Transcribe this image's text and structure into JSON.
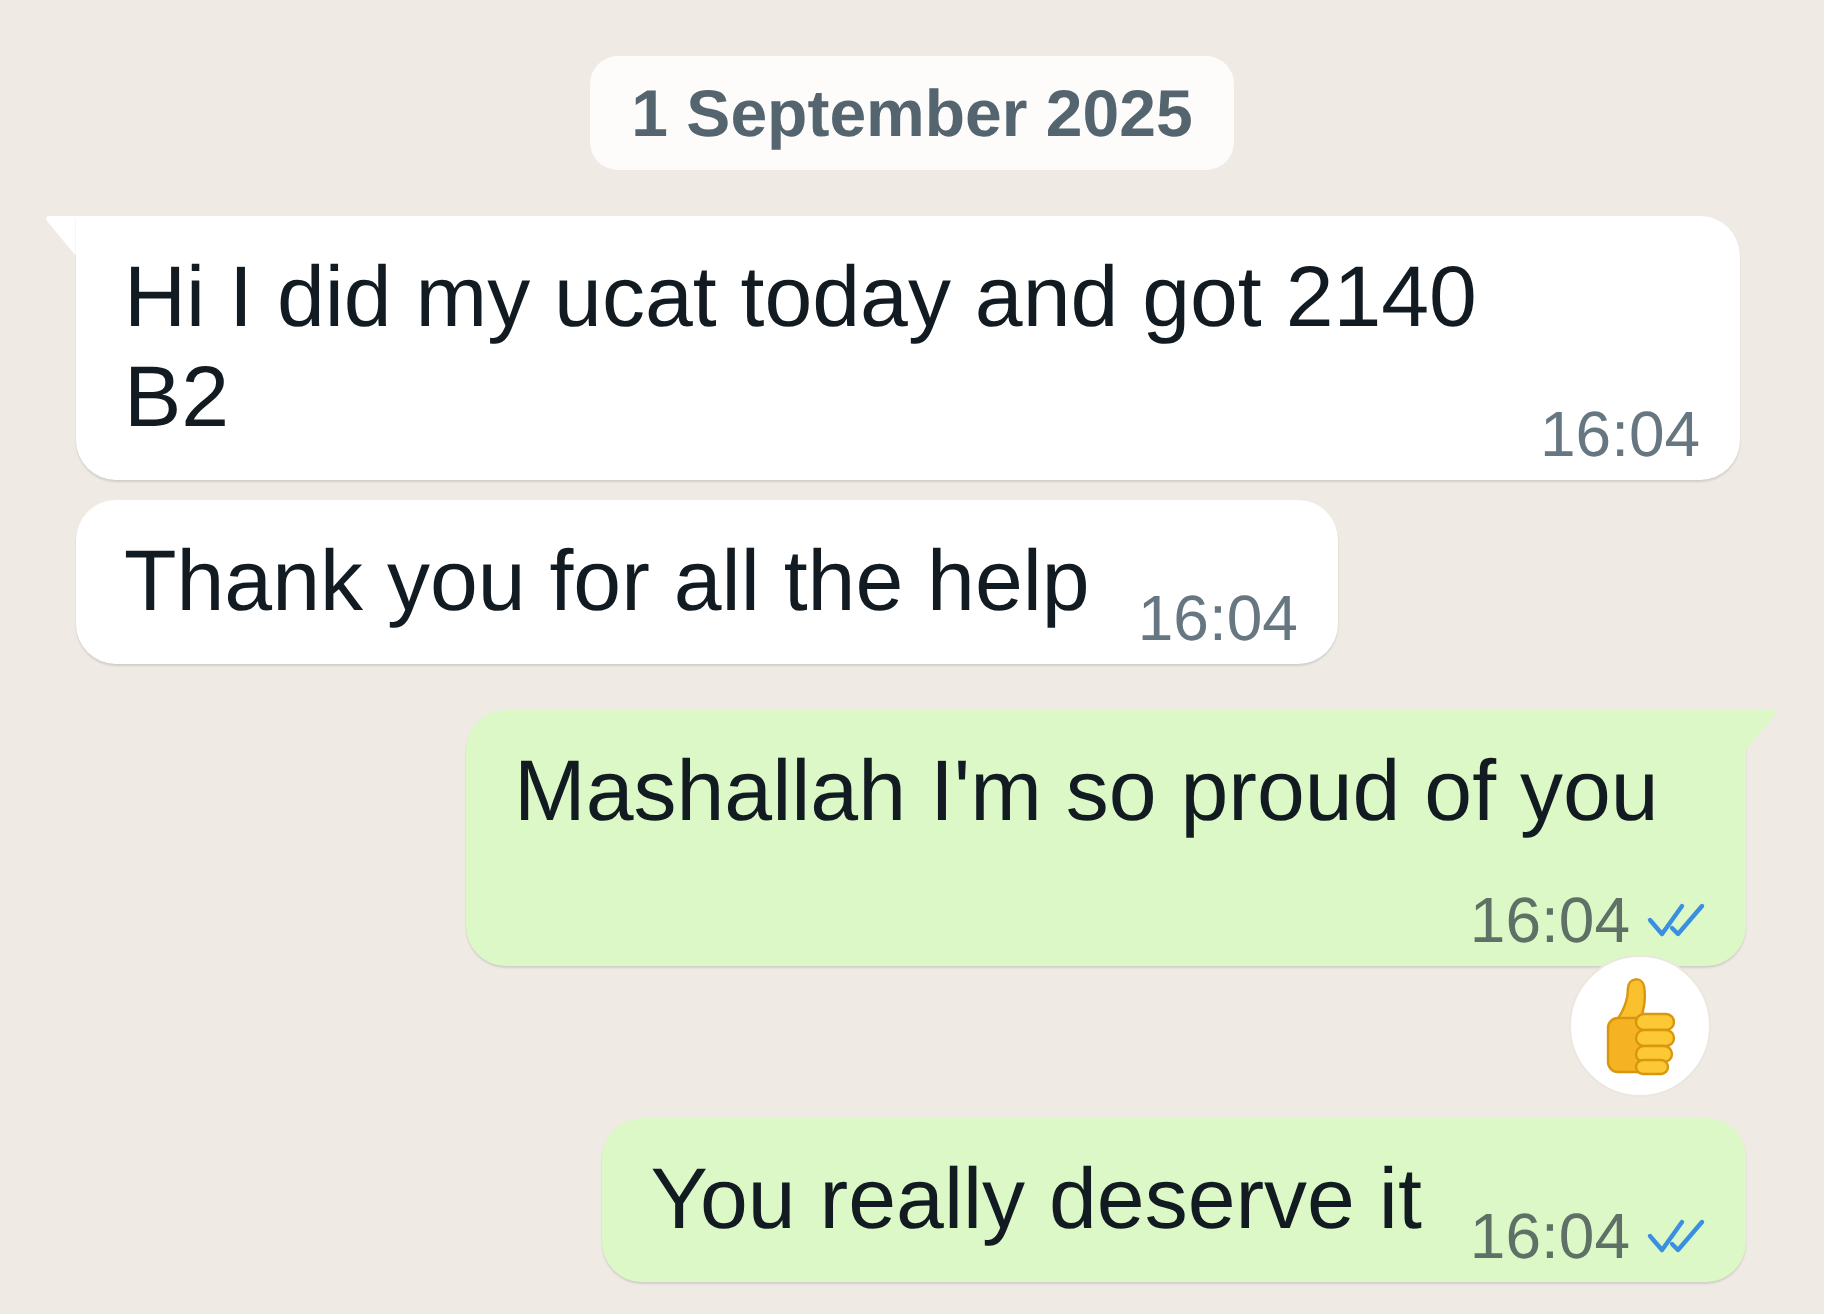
{
  "date_divider": "1 September 2025",
  "messages": [
    {
      "kind": "incoming",
      "tail": true,
      "text": "Hi I did my ucat today and got 2140 B2",
      "time": "16:04"
    },
    {
      "kind": "incoming",
      "tail": false,
      "text": "Thank you for all the help",
      "time": "16:04"
    },
    {
      "kind": "outgoing",
      "tail": true,
      "text": "Mashallah I'm so proud of you",
      "time": "16:04",
      "read": true,
      "reaction": {
        "kind": "thumbs_up"
      }
    },
    {
      "kind": "outgoing",
      "tail": false,
      "text": "You really deserve it",
      "time": "16:04",
      "read": true
    }
  ]
}
